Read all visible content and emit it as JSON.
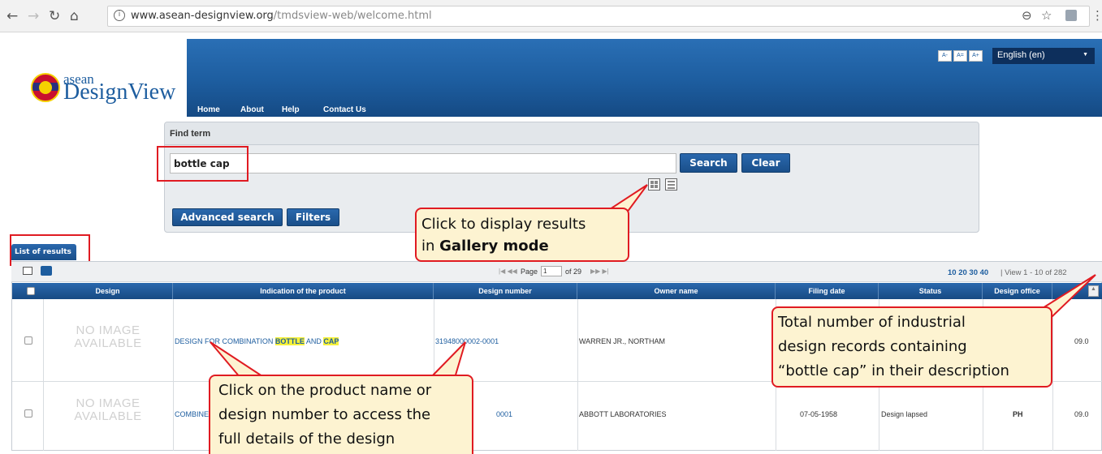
{
  "browser": {
    "url_domain": "www.asean-designview.org",
    "url_path": "/tmdsview-web/welcome.html"
  },
  "header": {
    "logo_small": "asean",
    "logo_big": "DesignView",
    "menu": [
      "Home",
      "About",
      "Help",
      "Contact Us"
    ],
    "font_buttons": [
      "A-",
      "A=",
      "A+"
    ],
    "language": "English (en)"
  },
  "find": {
    "title": "Find term",
    "query": "bottle cap",
    "search_label": "Search",
    "clear_label": "Clear",
    "advanced_label": "Advanced search",
    "filters_label": "Filters"
  },
  "results": {
    "tab_label": "List of results",
    "pager_page_label": "Page",
    "pager_page": "1",
    "pager_total": "of 29",
    "page_sizes": "10 20 30 40",
    "view_range": "| View 1 - 10 of 282",
    "columns": [
      "Design",
      "Indication of the product",
      "Design number",
      "Owner name",
      "Filing date",
      "Status",
      "Design office"
    ],
    "no_image": "NO IMAGE AVAILABLE",
    "rows": [
      {
        "product_prefix": "DESIGN FOR COMBINATION ",
        "product_hl1": "BOTTLE",
        "product_mid": " AND ",
        "product_hl2": "CAP",
        "design_number": "31948000002-0001",
        "owner": "WARREN JR., NORTHAM",
        "filing_date": "",
        "status": "",
        "office": "",
        "extra": "09.0"
      },
      {
        "product_prefix": "COMBINE",
        "design_number": "0001",
        "owner": "ABBOTT LABORATORIES",
        "filing_date": "07-05-1958",
        "status": "Design lapsed",
        "office": "PH",
        "extra": "09.0"
      }
    ]
  },
  "callouts": {
    "gallery_line1": "Click to display results",
    "gallery_line2_pre": "in ",
    "gallery_line2_bold": "Gallery mode",
    "total_line1": "Total number of industrial",
    "total_line2": "design records containing",
    "total_line3": "“bottle cap” in their description",
    "product_line1": "Click on the product name or",
    "product_line2": "design number to access the",
    "product_line3": "full details of the design"
  }
}
